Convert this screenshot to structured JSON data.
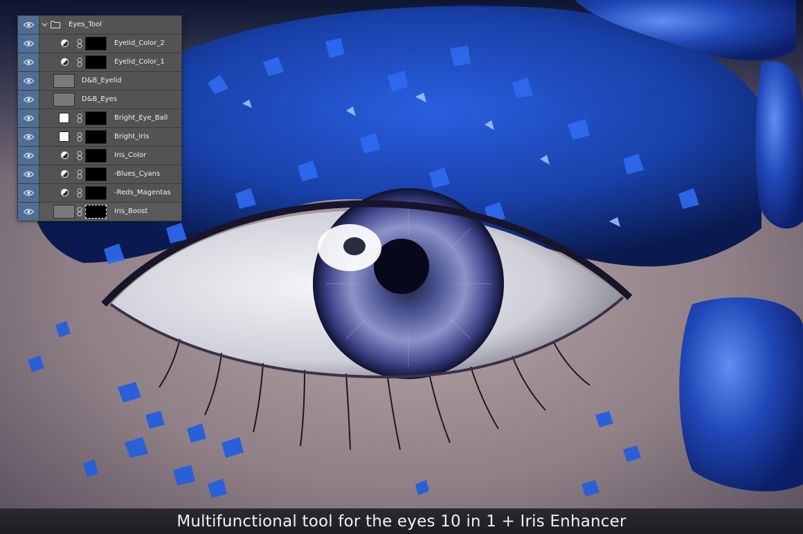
{
  "layers_panel": {
    "layers": [
      {
        "name": "Eyes_Tool",
        "type": "group",
        "visible": true
      },
      {
        "name": "Eyelid_Color_2",
        "type": "adjustment",
        "visible": true
      },
      {
        "name": "Eyelid_Color_1",
        "type": "adjustment",
        "visible": true
      },
      {
        "name": "D&B_Eyelid",
        "type": "gray-layer",
        "visible": true
      },
      {
        "name": "D&B_Eyes",
        "type": "gray-layer",
        "visible": true
      },
      {
        "name": "Bright_Eye_Ball",
        "type": "white-fill",
        "visible": true
      },
      {
        "name": "Bright_Iris",
        "type": "white-fill",
        "visible": true
      },
      {
        "name": "Iris_Color",
        "type": "adjustment",
        "visible": true
      },
      {
        "name": "-Blues_Cyans",
        "type": "adjustment",
        "visible": true
      },
      {
        "name": "-Reds_Magentas",
        "type": "adjustment",
        "visible": true
      },
      {
        "name": "Iris_Boost",
        "type": "gray-layer-masked",
        "visible": true
      }
    ]
  },
  "caption": {
    "text": "Multifunctional tool for the eyes 10 in 1 + Iris Enhancer"
  },
  "colors": {
    "panel_bg": "#535353",
    "eye_column_bg": "#4f6e96",
    "crystal_blue": "#1f52c8",
    "caption_bg": "#1f2024"
  }
}
